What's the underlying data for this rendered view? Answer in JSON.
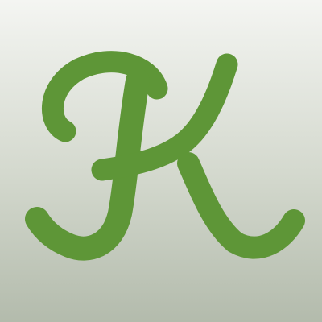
{
  "logo": {
    "letter": "K",
    "icon": "script-letter-k-logo-icon",
    "colors": {
      "stroke": "#5e9637",
      "background_top": "#f4f5f2",
      "background_bottom": "#b3bbac"
    }
  }
}
